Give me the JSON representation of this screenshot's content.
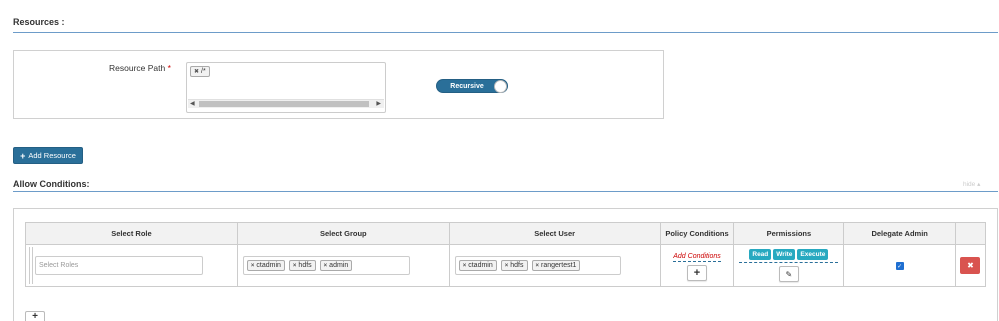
{
  "resources": {
    "header": "Resources :",
    "path_label": "Resource Path",
    "required_mark": "*",
    "path_tags": [
      {
        "label": "/*"
      }
    ],
    "recursive_label": "Recursive",
    "recursive_on": true,
    "add_resource_label": "Add Resource"
  },
  "allow": {
    "header": "Allow Conditions:",
    "hide_label": "hide",
    "columns": [
      "Select Role",
      "Select Group",
      "Select User",
      "Policy Conditions",
      "Permissions",
      "Delegate Admin",
      ""
    ],
    "row": {
      "role_placeholder": "Select Roles",
      "groups": [
        "ctadmin",
        "hdfs",
        "admin"
      ],
      "users": [
        "ctadmin",
        "hdfs",
        "rangertest1"
      ],
      "add_conditions_label": "Add Conditions",
      "permissions": [
        "Read",
        "Write",
        "Execute"
      ],
      "delegate_admin": true
    }
  },
  "colors": {
    "primary": "#2a6f99",
    "permission_tag": "#27a9c0",
    "danger": "#d9534f",
    "section_line": "#6d9cc9"
  }
}
